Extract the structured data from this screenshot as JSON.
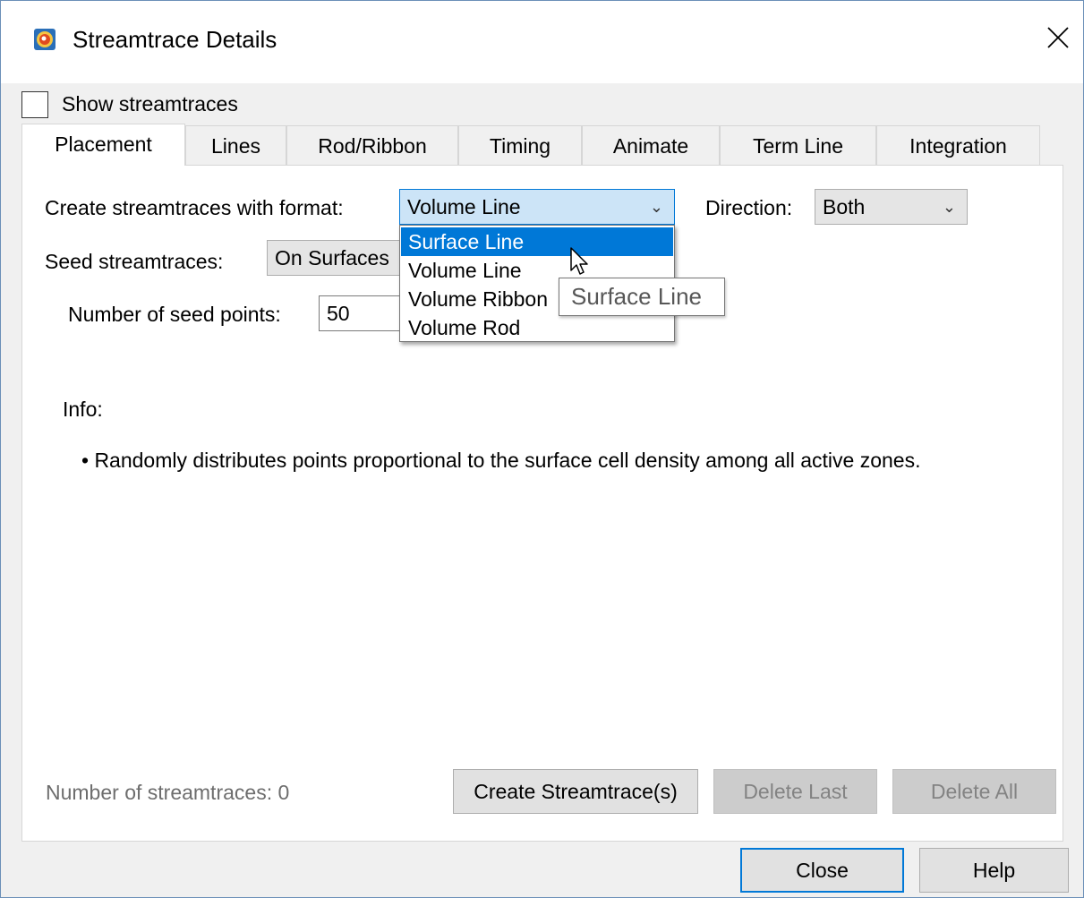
{
  "window": {
    "title": "Streamtrace Details",
    "icons": {
      "app": "app-icon",
      "close": "close-icon"
    }
  },
  "show_streamtraces": {
    "label": "Show streamtraces",
    "checked": false
  },
  "tabs": [
    {
      "label": "Placement",
      "active": true
    },
    {
      "label": "Lines",
      "active": false
    },
    {
      "label": "Rod/Ribbon",
      "active": false
    },
    {
      "label": "Timing",
      "active": false
    },
    {
      "label": "Animate",
      "active": false
    },
    {
      "label": "Term Line",
      "active": false
    },
    {
      "label": "Integration",
      "active": false
    }
  ],
  "placement": {
    "format_label": "Create streamtraces with format:",
    "format_value": "Volume Line",
    "direction_label": "Direction:",
    "direction_value": "Both",
    "seed_label": "Seed streamtraces:",
    "seed_value": "On Surfaces",
    "num_seed_label": "Number of seed points:",
    "num_seed_value": "50",
    "format_options": [
      "Surface Line",
      "Volume Line",
      "Volume Ribbon",
      "Volume Rod"
    ],
    "highlighted_option": "Surface Line",
    "tooltip": "Surface Line",
    "info_label": "Info:",
    "info_text": "• Randomly distributes points proportional to the surface cell density among all active zones."
  },
  "footer_panel": {
    "count_label": "Number of streamtraces:  0",
    "create_button": "Create Streamtrace(s)",
    "delete_last_button": "Delete Last",
    "delete_all_button": "Delete All"
  },
  "dialog_buttons": {
    "close": "Close",
    "help": "Help"
  },
  "colors": {
    "accent": "#0078d7",
    "highlight_bg": "#cce4f7"
  }
}
